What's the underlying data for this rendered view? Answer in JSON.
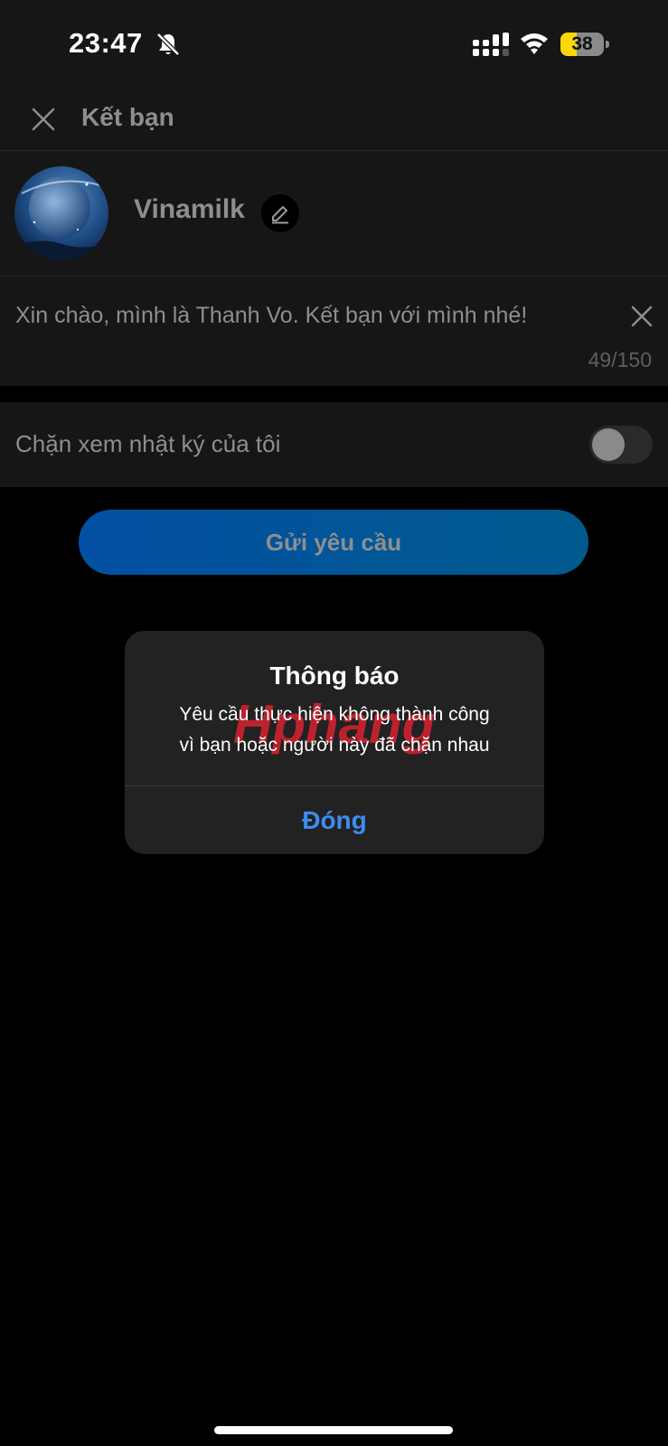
{
  "status_bar": {
    "time": "23:47",
    "battery_percent": "38",
    "battery_level": 0.38,
    "icons": [
      "bell-slash-icon",
      "signal-icon",
      "wifi-icon",
      "battery-icon"
    ]
  },
  "header": {
    "title": "Kết bạn",
    "close_icon": "close-icon"
  },
  "profile": {
    "display_name": "Vinamilk",
    "edit_icon": "pencil-icon"
  },
  "message": {
    "text": "Xin chào, mình là Thanh Vo. Kết bạn với mình nhé!",
    "char_count": "49/150",
    "clear_icon": "close-icon"
  },
  "block_diary": {
    "label": "Chặn xem nhật ký của tôi",
    "enabled": false
  },
  "send_button": {
    "label": "Gửi yêu cầu"
  },
  "dialog": {
    "title": "Thông báo",
    "message_line1": "Yêu cầu thực hiện không thành công",
    "message_line2": "vì bạn hoặc người này đã chặn nhau",
    "close_label": "Đóng",
    "watermark_text": "Hphang"
  },
  "colors": {
    "background": "#000000",
    "surface": "#161616",
    "dialog": "#222222",
    "accent_blue": "#3d8cf0",
    "button_blue": "#0250a3",
    "muted_text": "#8e8e8e",
    "battery_yellow": "#ffd60a"
  }
}
